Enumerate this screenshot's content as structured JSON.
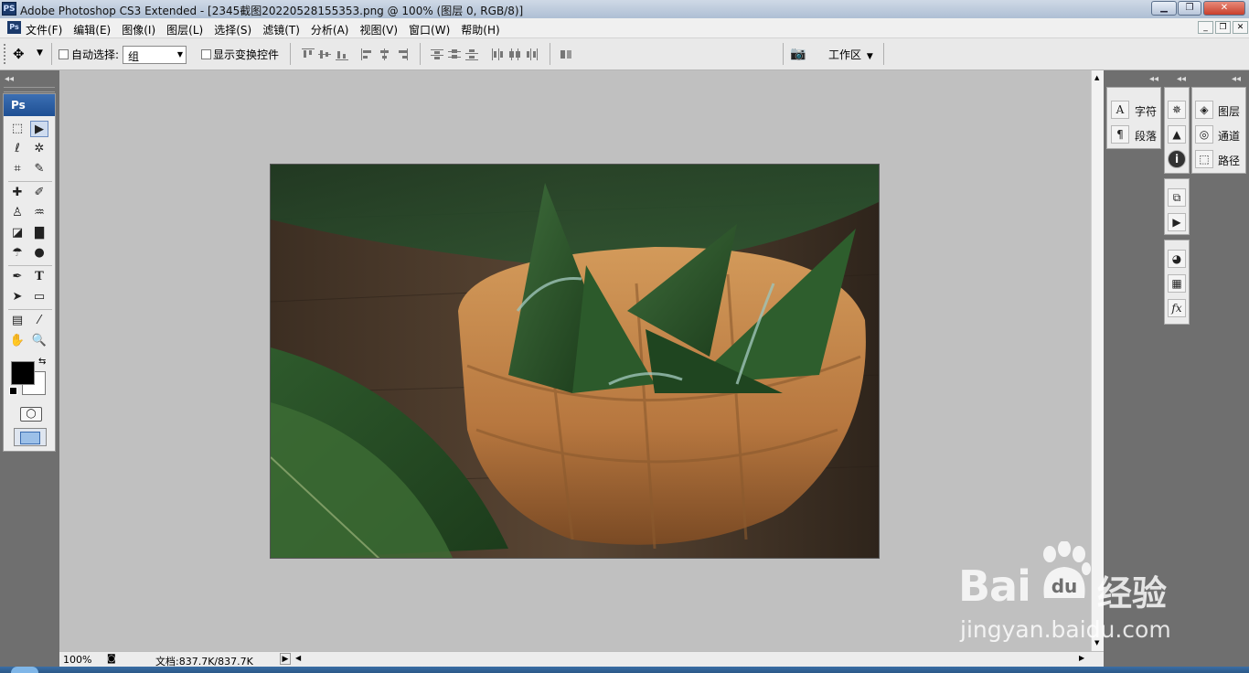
{
  "window": {
    "app_icon": "PS",
    "title": "Adobe Photoshop CS3 Extended - [2345截图20220528155353.png @ 100% (图层 0, RGB/8)]",
    "controls": [
      "minimize-icon",
      "maximize-icon",
      "close-icon"
    ]
  },
  "menu": {
    "app_icon": "Ps",
    "items": [
      "文件(F)",
      "编辑(E)",
      "图像(I)",
      "图层(L)",
      "选择(S)",
      "滤镜(T)",
      "分析(A)",
      "视图(V)",
      "窗口(W)",
      "帮助(H)"
    ]
  },
  "options": {
    "auto_select_label": "自动选择:",
    "auto_select_value": "组",
    "show_transform_label": "显示变换控件",
    "workspace_label": "工作区"
  },
  "toolbox": {
    "header": "Ps"
  },
  "status": {
    "zoom": "100%",
    "doc_info": "文档:837.7K/837.7K"
  },
  "panels": {
    "group1": [
      {
        "icon": "character-icon",
        "glyph": "A",
        "label": "字符"
      },
      {
        "icon": "paragraph-icon",
        "glyph": "¶",
        "label": "段落"
      }
    ],
    "group3": [
      {
        "icon": "layers-icon",
        "label": "图层"
      },
      {
        "icon": "channels-icon",
        "label": "通道"
      },
      {
        "icon": "paths-icon",
        "label": "路径"
      }
    ]
  },
  "watermark": {
    "brand_left": "Bai",
    "brand_right": "du",
    "brand_cn": "经验",
    "url": "jingyan.baidu.com"
  },
  "colors": {
    "foreground": "#000000",
    "background": "#ffffff",
    "toolbox_header": "#1e4f93"
  }
}
